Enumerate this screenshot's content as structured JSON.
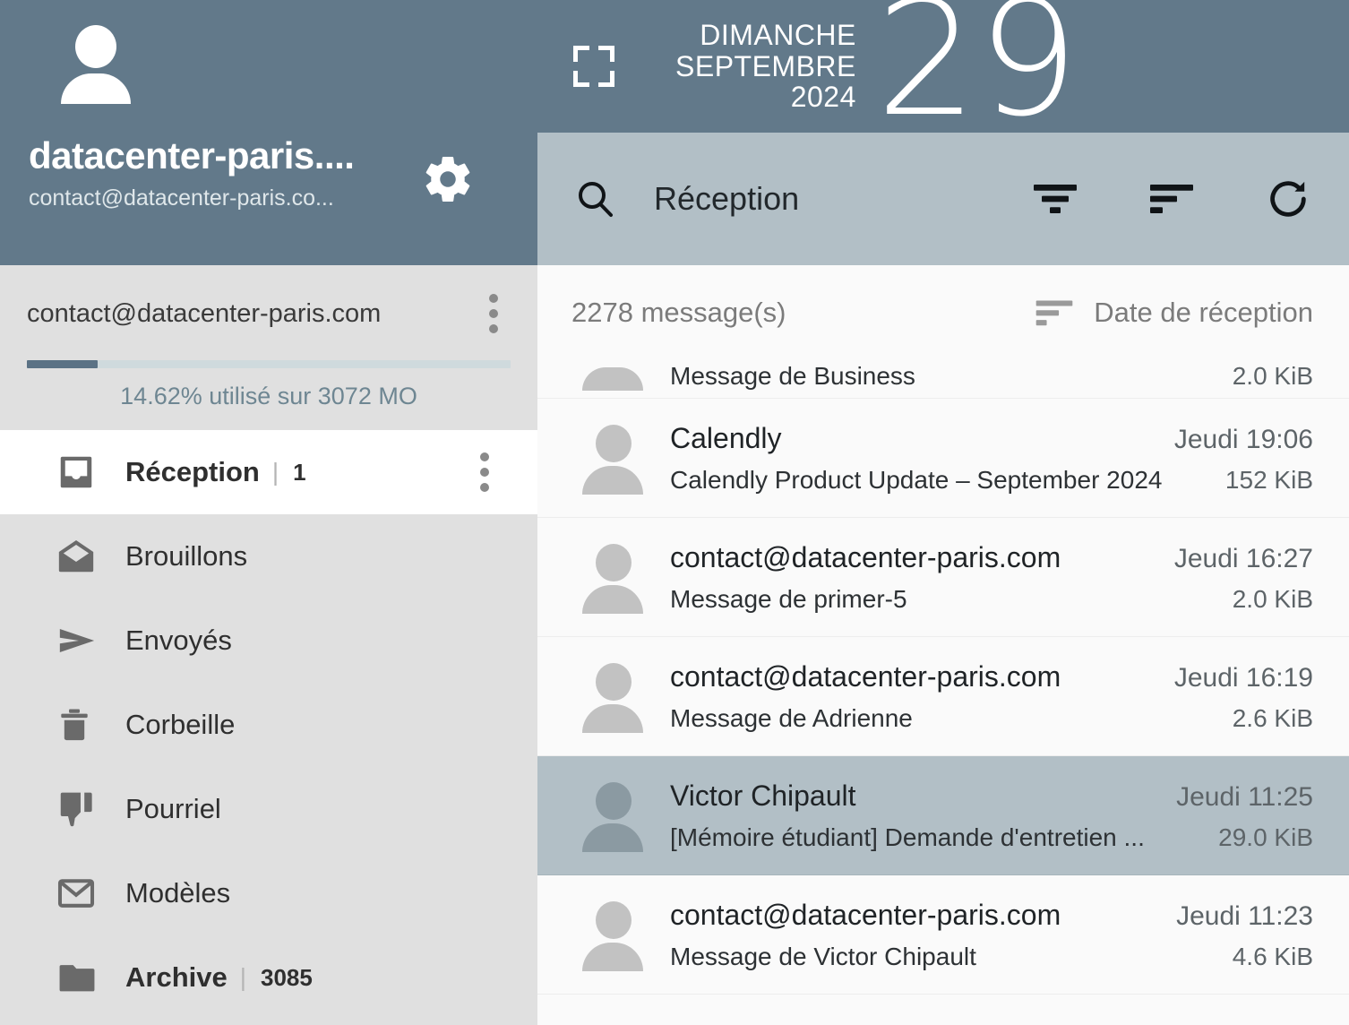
{
  "sidebar": {
    "account": {
      "avatar_icon": "person-icon",
      "name": "datacenter-paris....",
      "email": "contact@datacenter-paris.co...",
      "settings_icon": "gear-icon"
    },
    "storage": {
      "email": "contact@datacenter-paris.com",
      "menu_icon": "kebab-menu-icon",
      "percent_used": 14.62,
      "label": "14.62% utilisé sur 3072 MO",
      "bar_fill_color": "#5b7285",
      "bar_track_color": "#cfdadd"
    },
    "folders": [
      {
        "label": "Réception",
        "icon": "inbox-icon",
        "count": "1",
        "active": true,
        "bold": true,
        "has_menu": true
      },
      {
        "label": "Brouillons",
        "icon": "open-envelope-icon",
        "count": "",
        "active": false,
        "bold": false,
        "has_menu": false
      },
      {
        "label": "Envoyés",
        "icon": "paper-plane-icon",
        "count": "",
        "active": false,
        "bold": false,
        "has_menu": false
      },
      {
        "label": "Corbeille",
        "icon": "trash-icon",
        "count": "",
        "active": false,
        "bold": false,
        "has_menu": false
      },
      {
        "label": "Pourriel",
        "icon": "thumbs-down-icon",
        "count": "",
        "active": false,
        "bold": false,
        "has_menu": false
      },
      {
        "label": "Modèles",
        "icon": "envelope-icon",
        "count": "",
        "active": false,
        "bold": false,
        "has_menu": false
      },
      {
        "label": "Archive",
        "icon": "folder-icon",
        "count": "3085",
        "active": false,
        "bold": true,
        "has_menu": false
      }
    ]
  },
  "date_header": {
    "expand_icon": "fullscreen-icon",
    "weekday": "DIMANCHE",
    "month": "SEPTEMBRE",
    "year": "2024",
    "day": "29",
    "background_color": "#62798a"
  },
  "toolbar": {
    "search_icon": "search-icon",
    "title": "Réception",
    "filter_icon": "filter-icon",
    "sort_icon": "sort-icon",
    "refresh_icon": "refresh-icon",
    "background_color": "#b2bfc6"
  },
  "list_header": {
    "count_label": "2278 message(s)",
    "sort_icon": "sort-icon",
    "sort_label": "Date de réception"
  },
  "messages": [
    {
      "sender": "",
      "time": "",
      "subject": "Message de Business",
      "size": "2.0 KiB",
      "selected": false,
      "clipped": true
    },
    {
      "sender": "Calendly",
      "time": "Jeudi 19:06",
      "subject": "Calendly Product Update – September 2024",
      "size": "152 KiB",
      "selected": false,
      "clipped": false
    },
    {
      "sender": "contact@datacenter-paris.com",
      "time": "Jeudi 16:27",
      "subject": "Message de primer-5",
      "size": "2.0 KiB",
      "selected": false,
      "clipped": false
    },
    {
      "sender": "contact@datacenter-paris.com",
      "time": "Jeudi 16:19",
      "subject": "Message de Adrienne",
      "size": "2.6 KiB",
      "selected": false,
      "clipped": false
    },
    {
      "sender": "Victor Chipault",
      "time": "Jeudi 11:25",
      "subject": "[Mémoire étudiant] Demande d'entretien ...",
      "size": "29.0 KiB",
      "selected": true,
      "clipped": false
    },
    {
      "sender": "contact@datacenter-paris.com",
      "time": "Jeudi 11:23",
      "subject": "Message de Victor Chipault",
      "size": "4.6 KiB",
      "selected": false,
      "clipped": false
    }
  ]
}
